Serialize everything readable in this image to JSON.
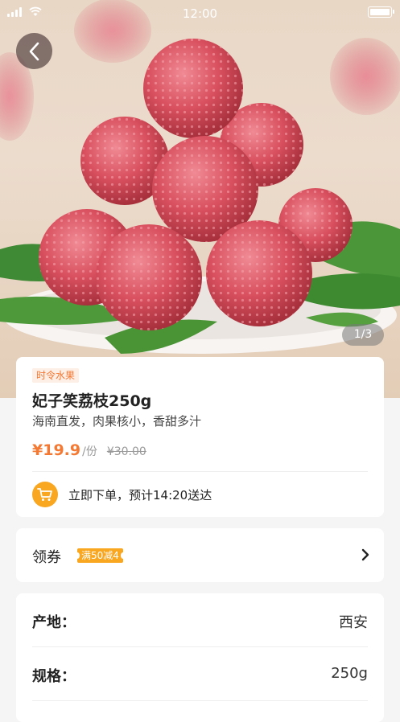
{
  "status_bar": {
    "time": "12:00"
  },
  "gallery": {
    "page_indicator": "1/3"
  },
  "product": {
    "category_tag": "时令水果",
    "name": "妃子笑荔枝250g",
    "description": "海南直发，肉果核小，香甜多汁",
    "price": "¥19.9",
    "unit": "/份",
    "original_price": "¥30.00",
    "delivery_text": "立即下单，预计14:20送达"
  },
  "coupon": {
    "label": "领券",
    "badge": "满50减4"
  },
  "specs": [
    {
      "key": "产地：",
      "value": "西安"
    },
    {
      "key": "规格：",
      "value": "250g"
    }
  ],
  "colors": {
    "accent": "#f47933",
    "badge": "#f9a620",
    "background": "#f5f5f5"
  },
  "icons": {
    "back": "chevron-left-icon",
    "cart": "cart-icon",
    "coupon_arrow": "chevron-right-icon"
  }
}
